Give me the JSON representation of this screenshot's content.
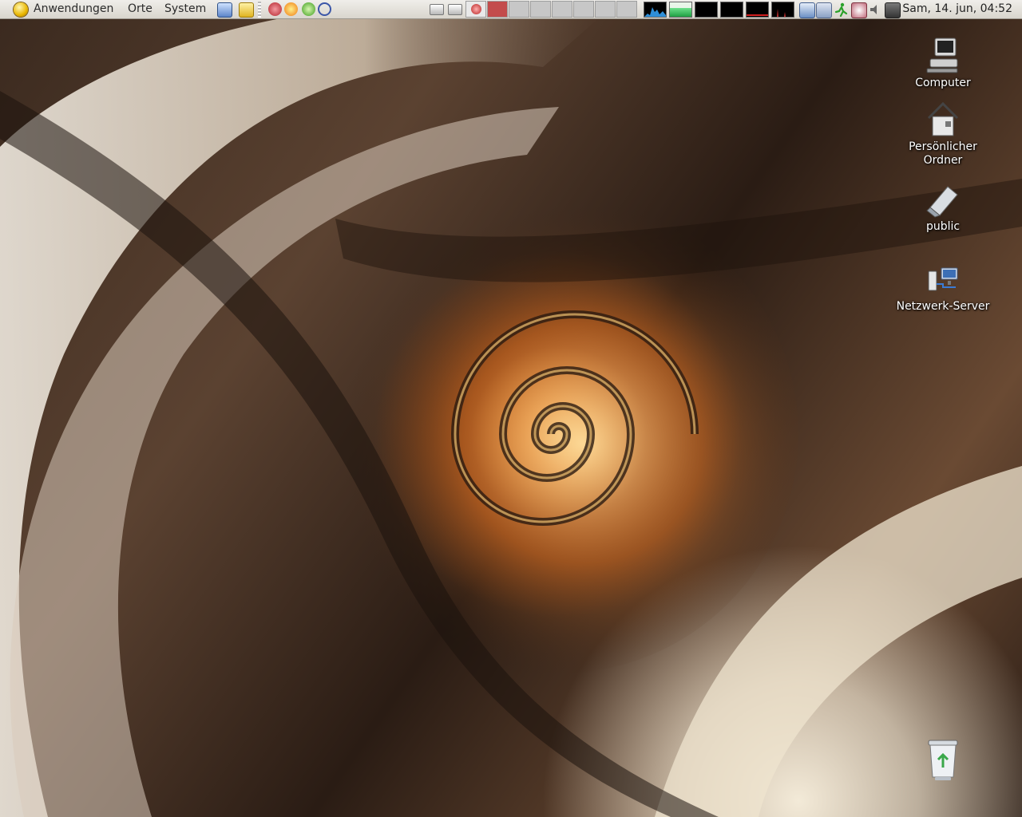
{
  "panel": {
    "menus": [
      "Anwendungen",
      "Orte",
      "System"
    ],
    "clock": "Sam, 14. jun, 04:52"
  },
  "desktop": {
    "icons": [
      {
        "label": "Computer",
        "icon": "computer-icon"
      },
      {
        "label": "Persönlicher Ordner",
        "icon": "home-folder-icon"
      },
      {
        "label": "public",
        "icon": "shared-folder-icon"
      },
      {
        "label": "Netzwerk-Server",
        "icon": "network-servers-icon"
      },
      {
        "label": "",
        "icon": "trash-icon"
      }
    ]
  },
  "colors": {
    "panel_bg": "#e6e3dd",
    "pager_active": "#c34c4c",
    "wallpaper_accent": "#e0872c"
  }
}
